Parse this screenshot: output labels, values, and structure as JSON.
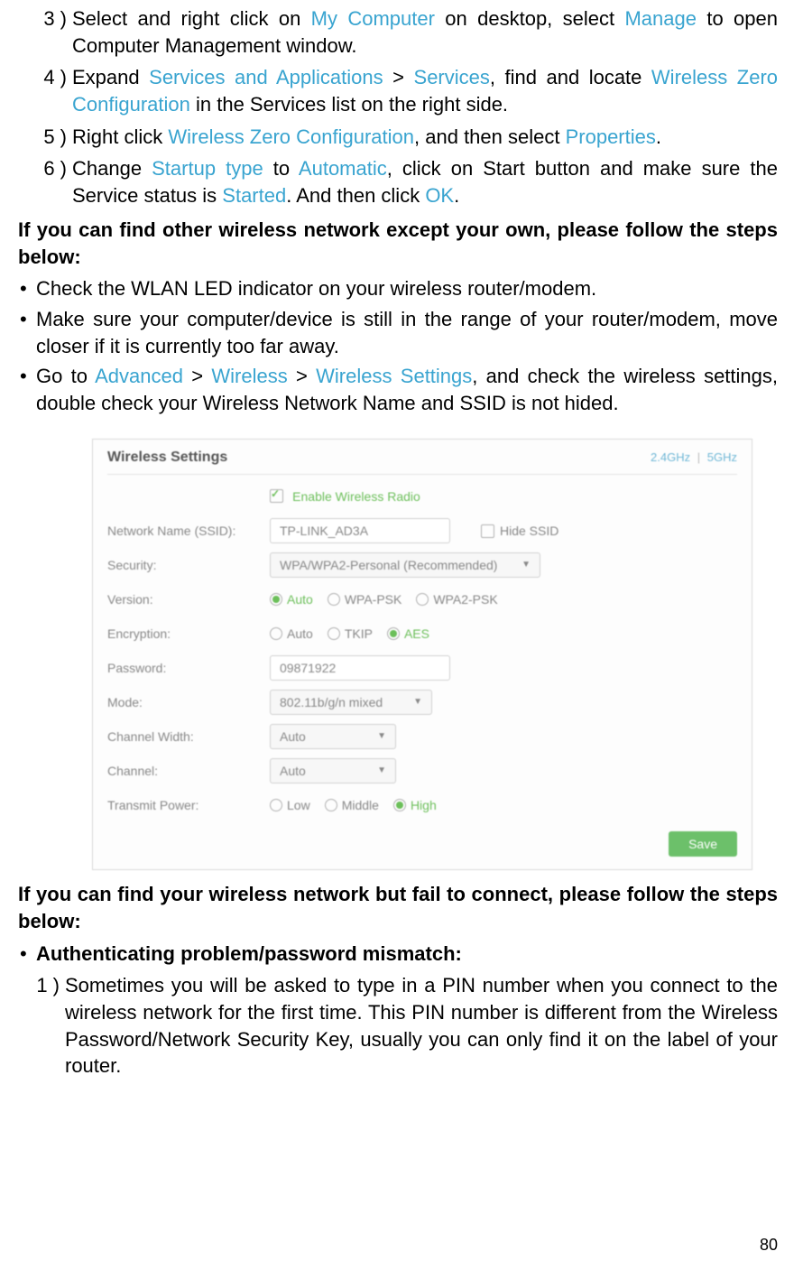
{
  "steps_a": [
    {
      "num": "3 )",
      "parts": [
        {
          "t": "Select and right click on "
        },
        {
          "t": "My Computer",
          "link": true
        },
        {
          "t": " on desktop, select "
        },
        {
          "t": "Manage",
          "link": true
        },
        {
          "t": " to open Computer Management window."
        }
      ]
    },
    {
      "num": "4 )",
      "parts": [
        {
          "t": "Expand "
        },
        {
          "t": "Services and Applications",
          "link": true
        },
        {
          "t": " > "
        },
        {
          "t": "Services",
          "link": true
        },
        {
          "t": ", find and locate "
        },
        {
          "t": "Wireless Zero Configuration",
          "link": true
        },
        {
          "t": " in the Services list on the right side."
        }
      ]
    },
    {
      "num": "5 )",
      "parts": [
        {
          "t": "Right click "
        },
        {
          "t": "Wireless Zero Configuration",
          "link": true
        },
        {
          "t": ", and then select "
        },
        {
          "t": "Properties",
          "link": true
        },
        {
          "t": "."
        }
      ]
    },
    {
      "num": "6 )",
      "parts": [
        {
          "t": "Change "
        },
        {
          "t": "Startup type",
          "link": true
        },
        {
          "t": " to "
        },
        {
          "t": "Automatic",
          "link": true
        },
        {
          "t": ", click on Start button and make sure the Service status is "
        },
        {
          "t": "Started",
          "link": true
        },
        {
          "t": ". And then click "
        },
        {
          "t": "OK",
          "link": true
        },
        {
          "t": "."
        }
      ]
    }
  ],
  "heading1": "If you can find other wireless network except your own, please follow the steps below:",
  "bullets1": [
    {
      "parts": [
        {
          "t": "Check the WLAN LED indicator on your wireless router/modem."
        }
      ]
    },
    {
      "parts": [
        {
          "t": "Make sure your computer/device is still in the range of your router/modem, move closer if it is currently too far away."
        }
      ]
    },
    {
      "parts": [
        {
          "t": "Go to "
        },
        {
          "t": "Advanced",
          "link": true
        },
        {
          "t": " > "
        },
        {
          "t": "Wireless",
          "link": true
        },
        {
          "t": " > "
        },
        {
          "t": "Wireless Settings",
          "link": true
        },
        {
          "t": ", and check the wireless settings, double check your Wireless Network Name and SSID is not hided."
        }
      ]
    }
  ],
  "ws": {
    "title": "Wireless Settings",
    "tab24": "2.4GHz",
    "tab5": "5GHz",
    "enable_label": "Enable Wireless Radio",
    "rows": {
      "ssid_label": "Network Name (SSID):",
      "ssid_value": "TP-LINK_AD3A",
      "hide_ssid": "Hide SSID",
      "security_label": "Security:",
      "security_value": "WPA/WPA2-Personal (Recommended)",
      "version_label": "Version:",
      "ver_auto": "Auto",
      "ver_wpa": "WPA-PSK",
      "ver_wpa2": "WPA2-PSK",
      "enc_label": "Encryption:",
      "enc_auto": "Auto",
      "enc_tkip": "TKIP",
      "enc_aes": "AES",
      "pwd_label": "Password:",
      "pwd_value": "09871922",
      "mode_label": "Mode:",
      "mode_value": "802.11b/g/n mixed",
      "cw_label": "Channel Width:",
      "cw_value": "Auto",
      "ch_label": "Channel:",
      "ch_value": "Auto",
      "tp_label": "Transmit Power:",
      "tp_low": "Low",
      "tp_mid": "Middle",
      "tp_high": "High"
    },
    "save": "Save"
  },
  "heading2": "If you can find your wireless network but fail to connect, please follow the steps below:",
  "bullet2_label": "Authenticating problem/password mismatch:",
  "step_b1_num": "1 )",
  "step_b1_text": "Sometimes you will be asked to type in a PIN number when you connect to the wireless network for the first time. This PIN number is different from the Wireless Password/Network Security Key, usually you can only find it on the label of your router.",
  "page_num": "80"
}
